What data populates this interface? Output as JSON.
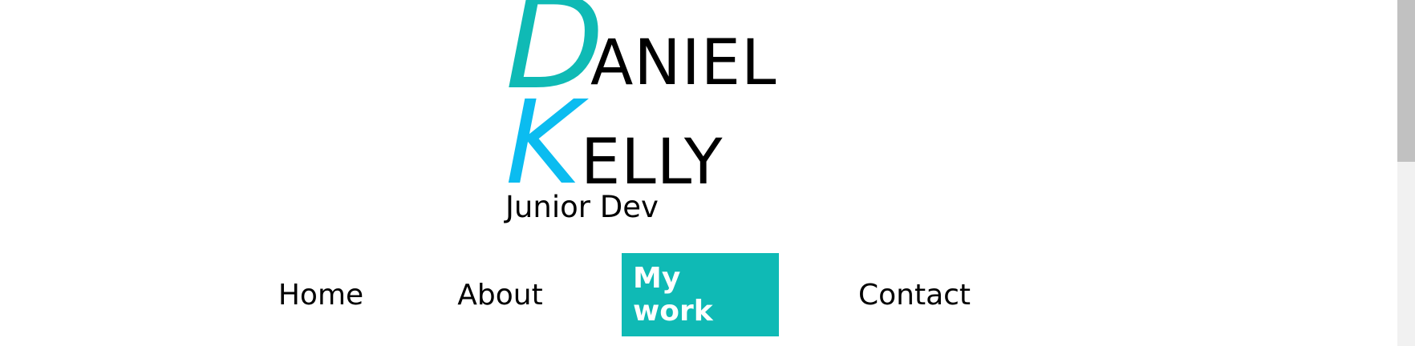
{
  "logo": {
    "first_initial": "D",
    "first_rest": "ANIEL",
    "last_initial": "K",
    "last_rest": "ELLY",
    "tagline": "Junior Dev",
    "colors": {
      "d_initial": "#0fbab5",
      "k_initial": "#0bbcf0"
    }
  },
  "nav": {
    "accent_color": "#0fbab5",
    "items": [
      {
        "label": "Home",
        "active": false
      },
      {
        "label": "About",
        "active": false
      },
      {
        "label": "My work",
        "active": true
      },
      {
        "label": "Contact",
        "active": false
      }
    ]
  },
  "scrollbar": {
    "thumb_color": "#c1c1c1",
    "track_color": "#f1f1f1"
  }
}
